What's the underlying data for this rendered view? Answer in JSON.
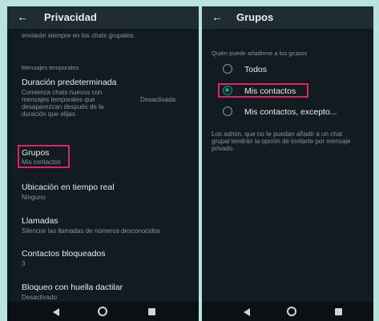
{
  "left": {
    "title": "Privacidad",
    "back_icon": "arrow-left-icon",
    "partial_top_text": "enviarán siempre en los chats grupales.",
    "section_label": "Mensajes temporales",
    "items": [
      {
        "primary": "Duración predeterminada",
        "secondary_lines": [
          "Comienza chats nuevos con",
          "mensajes temporales que",
          "desaparezcan después de la",
          "duración que elijas."
        ],
        "value": "Desactivada"
      },
      {
        "primary": "Grupos",
        "secondary": "Mis contactos"
      },
      {
        "primary": "Ubicación en tiempo real",
        "secondary": "Ninguno"
      },
      {
        "primary": "Llamadas",
        "secondary": "Silenciar las llamadas de números desconocidos"
      },
      {
        "primary": "Contactos bloqueados",
        "secondary": "3"
      },
      {
        "primary": "Bloqueo con huella dactilar",
        "secondary": "Desactivado"
      }
    ]
  },
  "right": {
    "title": "Grupos",
    "back_icon": "arrow-left-icon",
    "section_label": "Quién puede añadirme a los grupos",
    "options": [
      {
        "label": "Todos",
        "selected": false
      },
      {
        "label": "Mis contactos",
        "selected": true
      },
      {
        "label": "Mis contactos, excepto...",
        "selected": false
      }
    ],
    "note_lines": [
      "Los admin. que no te puedan añadir a un chat",
      "grupal tendrán la opción de invitarte por mensaje",
      "privado."
    ]
  },
  "colors": {
    "background": "#111b21",
    "appbar": "#1f2c33",
    "accent": "#00a884",
    "highlight": "#e0245e",
    "frame": "#b9e3de"
  },
  "nav_icons": [
    "back-triangle-icon",
    "home-circle-icon",
    "recents-square-icon"
  ]
}
